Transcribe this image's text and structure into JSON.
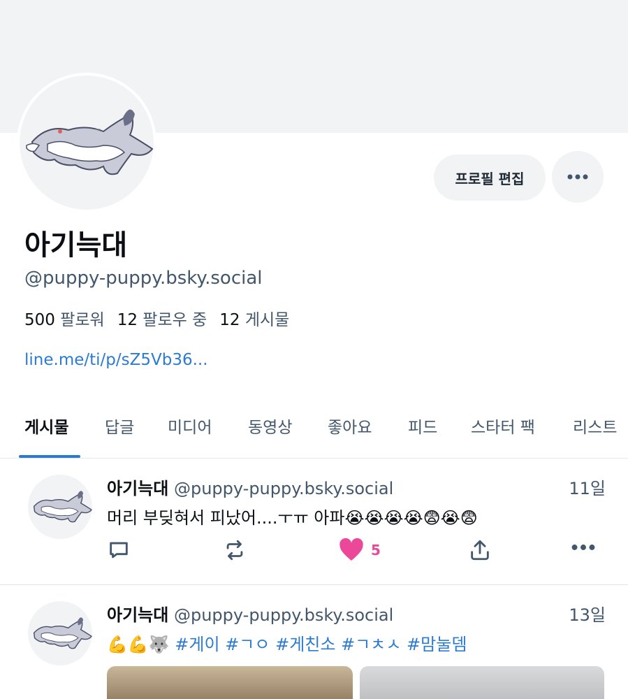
{
  "profile": {
    "display_name": "아기늑대",
    "handle": "@puppy-puppy.bsky.social",
    "followers_count": "500",
    "followers_label": "팔로워",
    "following_count": "12",
    "following_label": "팔로우 중",
    "posts_count": "12",
    "posts_label": "게시물",
    "link": "line.me/ti/p/sZ5Vb36...",
    "edit_button": "프로필 편집"
  },
  "tabs": [
    {
      "label": "게시물",
      "active": true
    },
    {
      "label": "답글",
      "active": false
    },
    {
      "label": "미디어",
      "active": false
    },
    {
      "label": "동영상",
      "active": false
    },
    {
      "label": "좋아요",
      "active": false
    },
    {
      "label": "피드",
      "active": false
    },
    {
      "label": "스타터 팩",
      "active": false
    },
    {
      "label": "리스트",
      "active": false
    }
  ],
  "posts": [
    {
      "author_name": "아기늑대",
      "author_handle": "@puppy-puppy.bsky.social",
      "date": "11일",
      "text": "머리 부딪혀서 피났어....ㅜㅠ 아파",
      "emoji": "😭😭😭😭😨😭😨",
      "like_count": "5"
    },
    {
      "author_name": "아기늑대",
      "author_handle": "@puppy-puppy.bsky.social",
      "date": "13일",
      "emoji": "💪💪🐺",
      "tags": "#게이 #ㄱㅇ #게친소 #ㄱㅊㅅ #맘눌뎀"
    }
  ],
  "icons": {
    "more": "ellipsis-icon",
    "reply": "reply-icon",
    "repost": "repost-icon",
    "like": "heart-icon",
    "share": "share-icon"
  },
  "colors": {
    "accent": "#2b7bd3",
    "like": "#ec4899",
    "muted": "#42576c"
  }
}
